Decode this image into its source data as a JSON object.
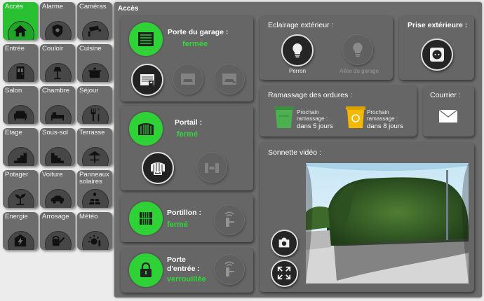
{
  "nav": [
    {
      "label": "Accès",
      "icon": "house-icon",
      "active": true
    },
    {
      "label": "Alarme",
      "icon": "shield-icon"
    },
    {
      "label": "Caméras",
      "icon": "camera-icon"
    },
    {
      "label": "Entrée",
      "icon": "door-icon"
    },
    {
      "label": "Couloir",
      "icon": "lamp-icon"
    },
    {
      "label": "Cuisine",
      "icon": "pot-icon"
    },
    {
      "label": "Salon",
      "icon": "sofa-icon"
    },
    {
      "label": "Chambre",
      "icon": "bed-icon"
    },
    {
      "label": "Séjour",
      "icon": "cutlery-icon"
    },
    {
      "label": "Etage",
      "icon": "stairs-icon"
    },
    {
      "label": "Sous-sol",
      "icon": "stairs-down-icon"
    },
    {
      "label": "Terrasse",
      "icon": "parasol-icon"
    },
    {
      "label": "Potager",
      "icon": "sprout-icon"
    },
    {
      "label": "Voiture",
      "icon": "car-icon"
    },
    {
      "label": "Panneaux solaires",
      "icon": "solar-panel-icon"
    },
    {
      "label": "Energie",
      "icon": "energy-icon"
    },
    {
      "label": "Arrosage",
      "icon": "watering-can-icon"
    },
    {
      "label": "Météo",
      "icon": "weather-icon"
    }
  ],
  "main": {
    "title": "Accès"
  },
  "garage": {
    "title": "Porte du garage :",
    "status": "fermée"
  },
  "portail": {
    "title": "Portail :",
    "status": "fermé"
  },
  "portillon": {
    "title": "Portillon :",
    "status": "fermé"
  },
  "porte": {
    "title_line1": "Porte",
    "title_line2": "d'entrée :",
    "status": "verrouillée"
  },
  "eclairage": {
    "title": "Eclairage extérieur :",
    "perron": "Perron",
    "allee": "Allée du garage"
  },
  "prise": {
    "title": "Prise extérieure :"
  },
  "ordures": {
    "title": "Ramassage des ordures :",
    "label1": "Prochain",
    "label2": "ramassage :",
    "green_value": "dans 5 jours",
    "yellow_value": "dans 8 jours"
  },
  "courrier": {
    "title": "Courrier :"
  },
  "sonnette": {
    "title": "Sonnette vidéo :"
  },
  "colors": {
    "accent": "#2ed236",
    "panel": "#666666",
    "background": "#ececec",
    "bin_green": "#4caf50",
    "bin_yellow": "#f5b800"
  }
}
